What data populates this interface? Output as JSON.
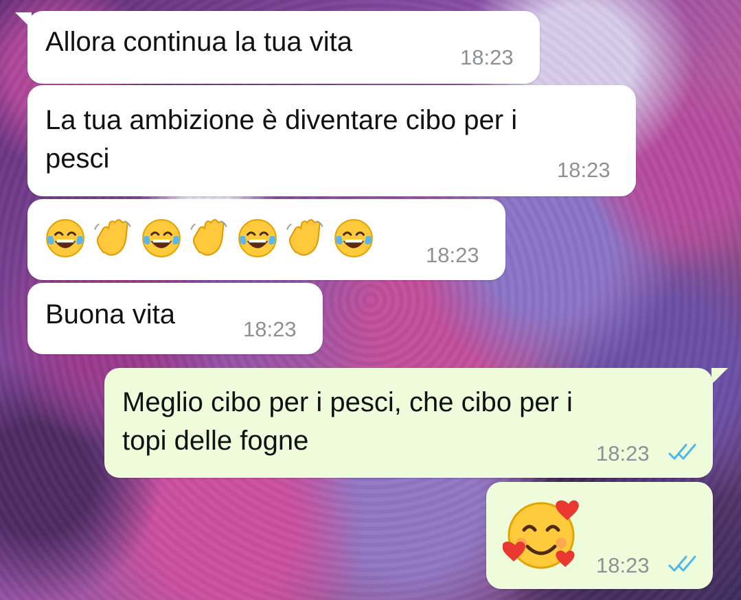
{
  "conversation": {
    "messages": [
      {
        "direction": "incoming",
        "text": "Allora continua la tua vita",
        "time": "18:23"
      },
      {
        "direction": "incoming",
        "text": "La tua ambizione è diventare cibo per i\npesci",
        "time": "18:23"
      },
      {
        "direction": "incoming",
        "text": "",
        "time": "18:23",
        "emoji_sequence": [
          "face-with-tears-of-joy-icon",
          "waving-hand-icon",
          "face-with-tears-of-joy-icon",
          "waving-hand-icon",
          "face-with-tears-of-joy-icon",
          "waving-hand-icon",
          "face-with-tears-of-joy-icon"
        ]
      },
      {
        "direction": "incoming",
        "text": "Buona vita",
        "time": "18:23"
      },
      {
        "direction": "outgoing",
        "text": "Meglio cibo per i pesci, che cibo per i\ntopi delle fogne",
        "time": "18:23",
        "status": "read"
      },
      {
        "direction": "outgoing",
        "text": "",
        "time": "18:23",
        "status": "read",
        "emoji": "smiling-face-with-hearts-icon"
      }
    ]
  },
  "theme": {
    "incoming_bubble": "#ffffff",
    "outgoing_bubble": "#eefcdc",
    "time_color": "#8d9094",
    "read_tick_color": "#4fb6ec"
  }
}
